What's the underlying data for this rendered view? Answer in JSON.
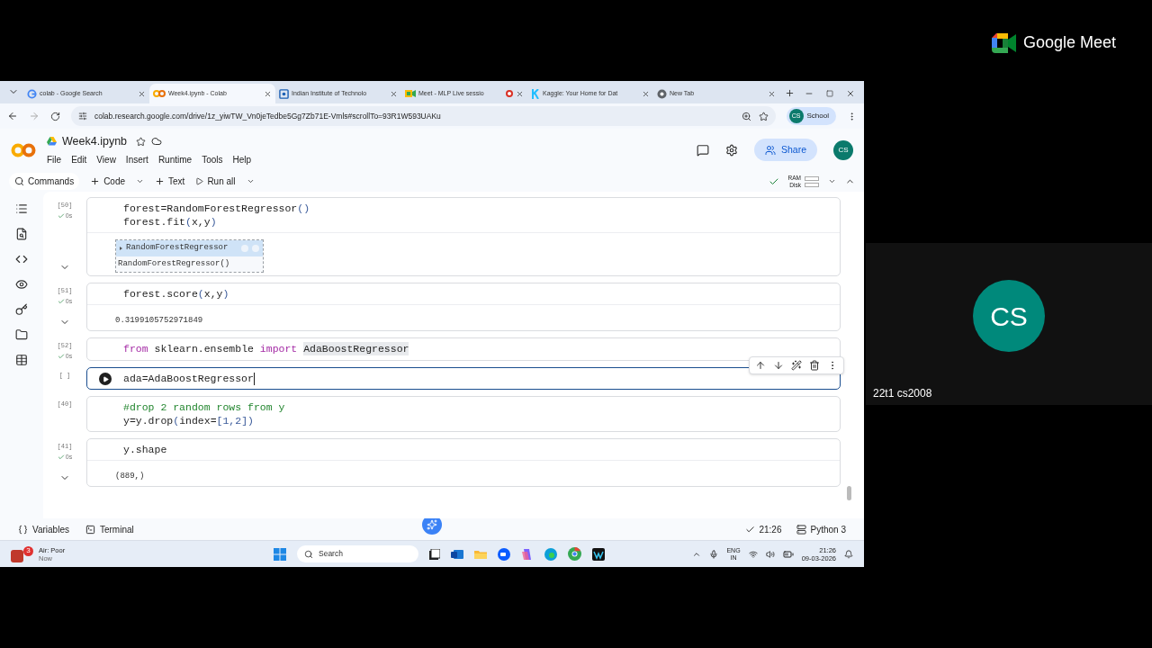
{
  "browser": {
    "tabs": [
      {
        "kind": "google",
        "title": "colab - Google Search",
        "selected": false,
        "recording": false
      },
      {
        "kind": "colab",
        "title": "Week4.ipynb - Colab",
        "selected": true,
        "recording": false
      },
      {
        "kind": "site",
        "title": "Indian Institute of Technolo",
        "selected": false,
        "recording": false
      },
      {
        "kind": "meet",
        "title": "Meet - MLP Live sessio",
        "selected": false,
        "recording": true
      },
      {
        "kind": "kaggle",
        "title": "Kaggle: Your Home for Dat",
        "selected": false,
        "recording": false
      },
      {
        "kind": "newtab",
        "title": "New Tab",
        "selected": false,
        "recording": false
      }
    ],
    "address": "colab.research.google.com/drive/1z_yiwTW_Vn0jeTedbe5Gg7Zb71E-Vmls#scrollTo=93R1W593UAKu",
    "profile": {
      "initials": "CS",
      "label": "School"
    }
  },
  "colab": {
    "title": "Week4.ipynb",
    "menu": [
      "File",
      "Edit",
      "View",
      "Insert",
      "Runtime",
      "Tools",
      "Help"
    ],
    "share": "Share",
    "avatar": "CS",
    "toolbar": {
      "commands": "Commands",
      "code": "Code",
      "text": "Text",
      "run_all": "Run all",
      "ram": "RAM",
      "disk": "Disk"
    },
    "cells": [
      {
        "count": "[50]",
        "ran": true,
        "time": "0s",
        "active": false,
        "lines": [
          [
            {
              "kind": "plain",
              "text": "forest=RandomForestRegressor"
            },
            {
              "kind": "bracket",
              "text": "()"
            }
          ],
          [
            {
              "kind": "plain",
              "text": "forest.fit"
            },
            {
              "kind": "bracket",
              "text": "("
            },
            {
              "kind": "plain",
              "text": "x,y"
            },
            {
              "kind": "bracket",
              "text": ")"
            }
          ]
        ],
        "output": {
          "kind": "estimator",
          "title": "RandomForestRegressor",
          "body": "RandomForestRegressor()"
        }
      },
      {
        "count": "[51]",
        "ran": true,
        "time": "0s",
        "active": false,
        "lines": [
          [
            {
              "kind": "plain",
              "text": "forest.score"
            },
            {
              "kind": "bracket",
              "text": "("
            },
            {
              "kind": "plain",
              "text": "x,y"
            },
            {
              "kind": "bracket",
              "text": ")"
            }
          ]
        ],
        "output": {
          "kind": "text",
          "text": "0.3199105752971849"
        }
      },
      {
        "count": "[52]",
        "ran": true,
        "time": "0s",
        "active": false,
        "lines": [
          [
            {
              "kind": "keyword",
              "text": "from"
            },
            {
              "kind": "plain",
              "text": " sklearn.ensemble "
            },
            {
              "kind": "keyword",
              "text": "import "
            },
            {
              "kind": "highlight",
              "text": "AdaBoostRegressor"
            }
          ]
        ]
      },
      {
        "count": "[ ]",
        "ran": false,
        "active": true,
        "lines": [
          [
            {
              "kind": "plain",
              "text": "ada=AdaBoostRegressor"
            }
          ]
        ]
      },
      {
        "count": "[40]",
        "ran": false,
        "active": false,
        "lines": [
          [
            {
              "kind": "comment",
              "text": "#drop 2 random rows from y"
            }
          ],
          [
            {
              "kind": "plain",
              "text": "y=y.drop"
            },
            {
              "kind": "bracket",
              "text": "("
            },
            {
              "kind": "plain",
              "text": "index="
            },
            {
              "kind": "bracket",
              "text": "[1,2])"
            }
          ]
        ]
      },
      {
        "count": "[41]",
        "ran": true,
        "time": "0s",
        "active": false,
        "lines": [
          [
            {
              "kind": "plain",
              "text": "y.shape"
            }
          ]
        ],
        "output": {
          "kind": "text",
          "text": "(889,)"
        }
      }
    ],
    "status_bar": {
      "variables": "Variables",
      "terminal": "Terminal",
      "time": "21:26",
      "runtime": "Python 3"
    }
  },
  "taskbar": {
    "weather": {
      "badge": "3",
      "title": "Air: Poor",
      "subtitle": "Now"
    },
    "search": "Search",
    "language": "ENG",
    "region": "IN",
    "time": "21:26",
    "date": "09-03-2026"
  },
  "meet": {
    "logo_text": "Google Meet",
    "participant": {
      "initials": "CS",
      "name": "22t1 cs2008"
    }
  }
}
